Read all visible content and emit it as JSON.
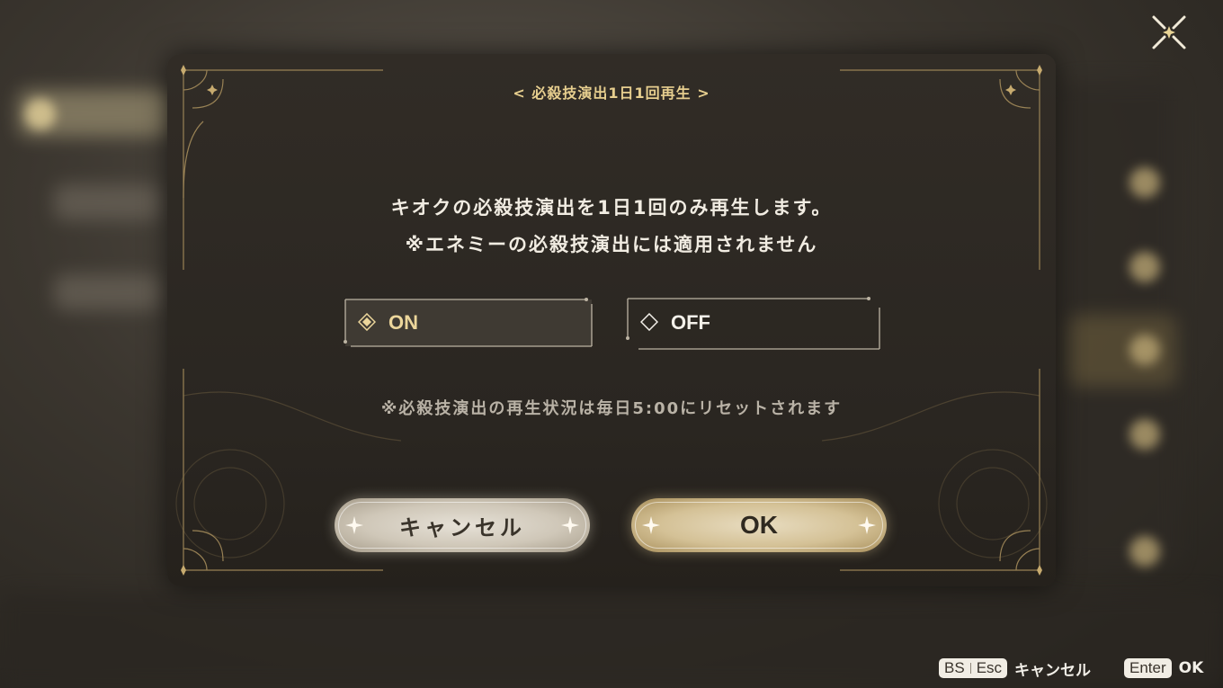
{
  "dialog": {
    "title": "< 必殺技演出1日1回再生 >",
    "message_line1": "キオクの必殺技演出を1日1回のみ再生します。",
    "message_line2": "※エネミーの必殺技演出には適用されません",
    "note": "※必殺技演出の再生状況は毎日5:00にリセットされます",
    "options": [
      {
        "label": "ON",
        "selected": true
      },
      {
        "label": "OFF",
        "selected": false
      }
    ],
    "cancel_label": "キャンセル",
    "ok_label": "OK"
  },
  "footer": {
    "cancel_keys": [
      "BS",
      "Esc"
    ],
    "cancel_label": "キャンセル",
    "ok_key": "Enter",
    "ok_label": "OK"
  },
  "colors": {
    "accent_gold": "#e7cf8f",
    "modal_bg": "#2c2823",
    "text_light": "#f1ece2",
    "note_gray": "#b9b2a6"
  }
}
